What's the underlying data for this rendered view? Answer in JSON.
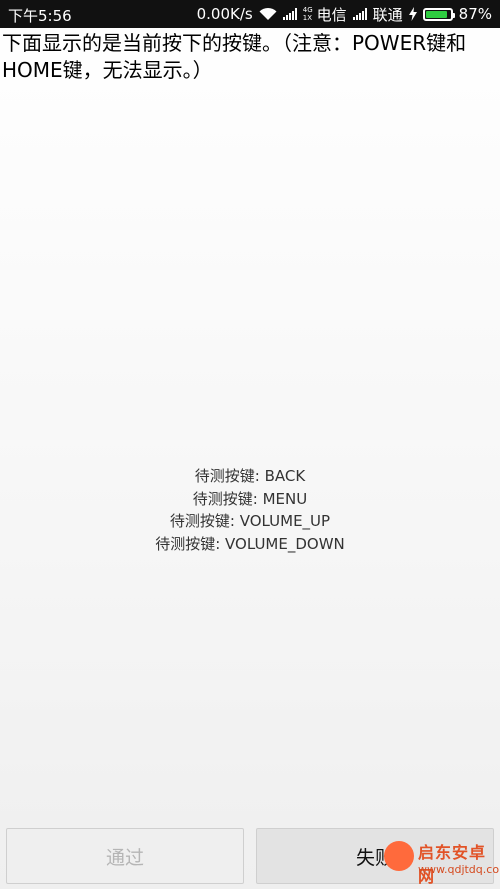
{
  "status_bar": {
    "time": "下午5:56",
    "net_speed": "0.00K/s",
    "sim1_type_top": "4G",
    "sim1_type_bottom": "1X",
    "carrier1": "电信",
    "carrier2": "联通",
    "battery_percent_text": "87%",
    "battery_level": 0.87
  },
  "title": "下面显示的是当前按下的按键。（注意：POWER键和HOME键，无法显示。）",
  "pending_keys": [
    "待测按键: BACK",
    "待测按键: MENU",
    "待测按键: VOLUME_UP",
    "待测按键: VOLUME_DOWN"
  ],
  "buttons": {
    "pass": "通过",
    "fail": "失败"
  },
  "watermark": {
    "text": "启东安卓网",
    "url": "www.qdjtdq.com"
  }
}
